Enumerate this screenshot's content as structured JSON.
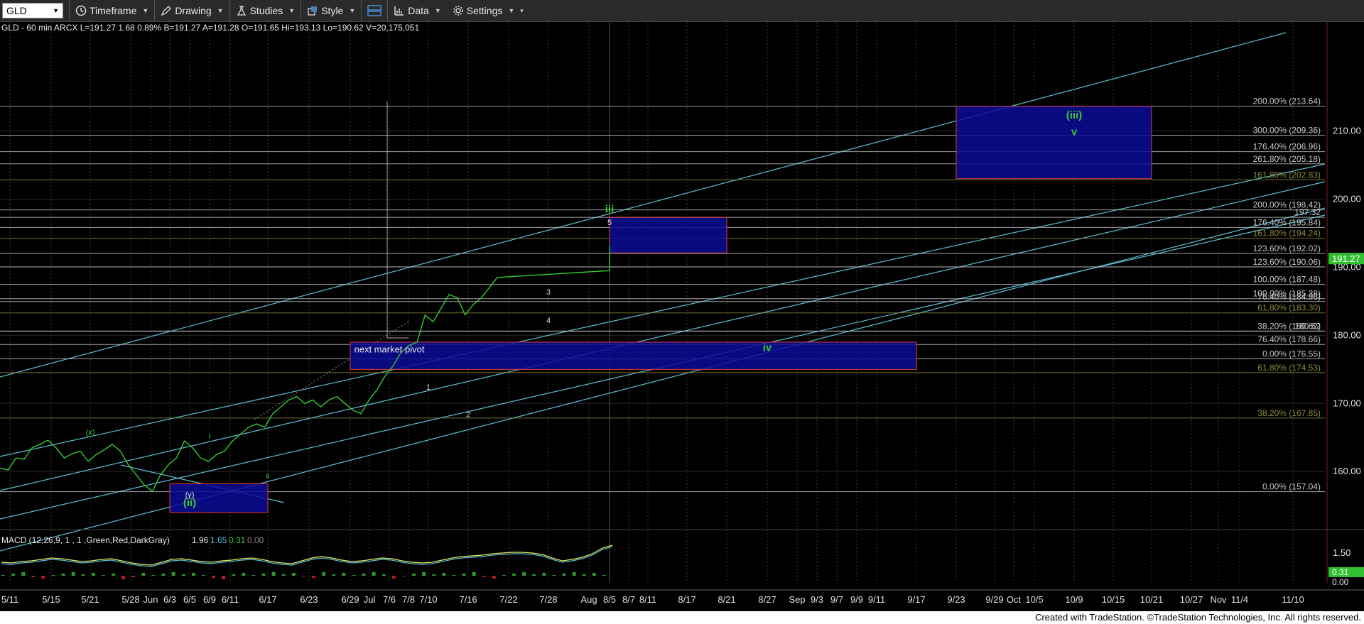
{
  "toolbar": {
    "symbol": "GLD",
    "items": [
      {
        "label": "Timeframe",
        "icon": "clock-icon"
      },
      {
        "label": "Drawing",
        "icon": "pencil-icon"
      },
      {
        "label": "Studies",
        "icon": "studies-icon"
      },
      {
        "label": "Style",
        "icon": "style-icon"
      },
      {
        "label": "",
        "icon": "layout-icon"
      },
      {
        "label": "Data",
        "icon": "data-icon"
      },
      {
        "label": "Settings",
        "icon": "gear-icon"
      }
    ]
  },
  "header_text": "GLD - 60 min  ARCX  L=191.27  1.68  0.89%  B=191.27  A=191.28  O=191.65  Hi=193.13  Lo=190.62  V=20,175,051",
  "footer_text": "Created with TradeStation. ©TradeStation Technologies, Inc. All rights reserved.",
  "colors": {
    "price": "#33cc33",
    "channel": "#5bbfd6",
    "fib_white": "#c8c8c8",
    "fib_olive": "#8c8c3a",
    "box_fill": "#0a0a96",
    "box_border": "#e23c3c",
    "label_green": "#33cc33",
    "macd_yellow": "#e8e85a",
    "macd_blue": "#5bbfd6",
    "macd_hist_green": "#2e9a2e",
    "macd_hist_red": "#b02020"
  },
  "chart_data": {
    "type": "line",
    "title": "GLD - 60 min",
    "y_axis": {
      "min": 152,
      "max": 226,
      "ticks": [
        160.0,
        170.0,
        180.0,
        190.0,
        200.0,
        210.0
      ]
    },
    "current_price": "191.27",
    "x_labels": [
      "5/11",
      "5/15",
      "5/21",
      "5/28",
      "Jun",
      "6/3",
      "6/5",
      "6/9",
      "6/11",
      "6/17",
      "6/23",
      "6/29",
      "Jul",
      "7/6",
      "7/8",
      "7/10",
      "7/16",
      "7/22",
      "7/28",
      "Aug",
      "8/5",
      "8/7",
      "8/11",
      "8/17",
      "8/21",
      "8/27",
      "Sep",
      "9/3",
      "9/7",
      "9/9",
      "9/11",
      "9/17",
      "9/23",
      "9/29",
      "Oct",
      "10/5",
      "10/9",
      "10/15",
      "10/21",
      "10/27",
      "Nov",
      "11/4",
      "11/10"
    ],
    "series": [
      {
        "x": [
          0,
          1,
          2,
          3,
          4,
          5,
          6,
          7,
          8,
          9,
          10,
          11,
          12,
          13,
          14,
          15,
          16,
          17,
          18,
          19,
          20,
          21,
          22,
          23,
          24,
          25,
          26,
          27,
          28,
          29,
          30,
          31,
          32,
          33,
          34,
          35,
          36,
          37,
          38,
          39,
          40,
          41,
          42,
          43,
          44,
          45,
          46,
          47,
          48,
          49,
          50,
          51,
          52,
          53,
          54,
          55,
          56,
          57,
          58,
          59,
          60,
          61,
          62
        ],
        "y": [
          160.5,
          160.2,
          162.0,
          161.8,
          163.5,
          164.0,
          164.6,
          163.5,
          162.0,
          162.6,
          163.0,
          161.5,
          162.5,
          163.2,
          164.0,
          163.0,
          161.0,
          159.5,
          158.0,
          157.1,
          159.5,
          161.0,
          162.0,
          164.5,
          163.5,
          162.0,
          161.5,
          162.5,
          163.0,
          164.5,
          165.5,
          166.5,
          167.0,
          166.5,
          168.5,
          169.5,
          170.5,
          171.0,
          170.0,
          170.5,
          169.5,
          170.5,
          171.0,
          170.0,
          169.0,
          168.5,
          170.5,
          172.0,
          174.0,
          175.5,
          177.5,
          178.5,
          179.0,
          183.0,
          182.0,
          184.0,
          186.0,
          185.5,
          183.0,
          184.5,
          185.5,
          187.0,
          188.5
        ]
      }
    ],
    "price_tail": [
      {
        "date": "8/5",
        "y": 189.5
      },
      {
        "date": "8/5",
        "y": 193.13
      },
      {
        "date": "8/5",
        "y": 191.27
      }
    ],
    "fib_levels": [
      {
        "label": "200.00% (213.64)",
        "value": 213.64,
        "color": "white"
      },
      {
        "label": "300.00% (209.36)",
        "value": 209.36,
        "color": "white"
      },
      {
        "label": "176.40% (206.96)",
        "value": 206.96,
        "color": "white"
      },
      {
        "label": "261.80% (205.18)",
        "value": 205.18,
        "color": "white"
      },
      {
        "label": "161.80% (202.83)",
        "value": 202.83,
        "color": "olive"
      },
      {
        "label": "200.00% (198.42)",
        "value": 198.42,
        "color": "white"
      },
      {
        "label": "197.32",
        "value": 197.32,
        "color": "white"
      },
      {
        "label": "176.40% (195.84)",
        "value": 195.84,
        "color": "white"
      },
      {
        "label": "161.80% (194.24)",
        "value": 194.24,
        "color": "olive"
      },
      {
        "label": "123.60% (192.02)",
        "value": 192.02,
        "color": "white"
      },
      {
        "label": "123.60% (190.06)",
        "value": 190.06,
        "color": "white"
      },
      {
        "label": "100.00% (187.48)",
        "value": 187.48,
        "color": "white"
      },
      {
        "label": "100.00% (185.38)",
        "value": 185.38,
        "color": "white"
      },
      {
        "label": "76.40% (184.96)",
        "value": 184.96,
        "color": "white"
      },
      {
        "label": "61.80% (183.30)",
        "value": 183.3,
        "color": "olive"
      },
      {
        "label": "38.20% (180.62)",
        "value": 180.62,
        "color": "white"
      },
      {
        "label": "180.62",
        "value": 180.62,
        "color": "white"
      },
      {
        "label": "76.40% (178.66)",
        "value": 178.66,
        "color": "white"
      },
      {
        "label": "0.00% (176.55)",
        "value": 176.55,
        "color": "white"
      },
      {
        "label": "61.80% (174.53)",
        "value": 174.53,
        "color": "olive"
      },
      {
        "label": "38.20% (167.85)",
        "value": 167.85,
        "color": "olive"
      },
      {
        "label": "0.00% (157.04)",
        "value": 157.04,
        "color": "white"
      }
    ],
    "boxes": [
      {
        "x_from": "9/23",
        "x_to": "10/21",
        "y_from": 203.0,
        "y_to": 213.64
      },
      {
        "x_from": "8/5",
        "x_to": "8/21",
        "y_from": 192.1,
        "y_to": 197.3
      },
      {
        "x_from": "6/29",
        "x_to": "9/17",
        "y_from": 175.0,
        "y_to": 179.0
      },
      {
        "x_from": "6/3",
        "x_to": "6/17",
        "y_from": 154.0,
        "y_to": 158.2
      }
    ],
    "wave_labels": [
      {
        "text": "(iii)",
        "x": "10/9",
        "y": 211.8
      },
      {
        "text": "v",
        "x": "10/9",
        "y": 209.4
      },
      {
        "text": "iii",
        "x": "8/5",
        "y": 198.0
      },
      {
        "text": "5",
        "x": "8/5",
        "y": 196.2
      },
      {
        "text": "3",
        "x": "7/28",
        "y": 186.0
      },
      {
        "text": "4",
        "x": "7/28",
        "y": 181.8
      },
      {
        "text": "iv",
        "x": "8/27",
        "y": 177.7
      },
      {
        "text": "next market pivot",
        "x": "7/6",
        "y": 177.5
      },
      {
        "text": "1",
        "x": "7/10",
        "y": 172.0
      },
      {
        "text": "2",
        "x": "7/16",
        "y": 168.0
      },
      {
        "text": "(x)",
        "x": "5/21",
        "y": 165.4
      },
      {
        "text": "i",
        "x": "6/9",
        "y": 164.8
      },
      {
        "text": "ii",
        "x": "6/17",
        "y": 159.0
      },
      {
        "text": "(y)",
        "x": "6/5",
        "y": 156.2
      },
      {
        "text": "(ii)",
        "x": "6/5",
        "y": 154.9
      }
    ],
    "macd": {
      "label": "MACD (12,26,9, 1 , 1 ,Green,Red,DarkGray)",
      "values": [
        "1.96",
        "1.65",
        "0.31",
        "0.00"
      ],
      "axis_label": "1.50",
      "hist_label": "0.31",
      "zero_label": "0.00"
    }
  }
}
